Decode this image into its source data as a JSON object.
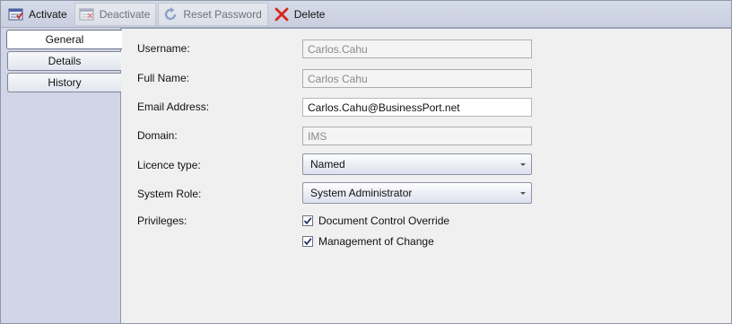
{
  "toolbar": {
    "activate_label": "Activate",
    "deactivate_label": "Deactivate",
    "reset_password_label": "Reset Password",
    "delete_label": "Delete"
  },
  "tabs": [
    {
      "label": "General",
      "active": true
    },
    {
      "label": "Details",
      "active": false
    },
    {
      "label": "History",
      "active": false
    }
  ],
  "form": {
    "username": {
      "label": "Username:",
      "value": "Carlos.Cahu",
      "editable": false
    },
    "full_name": {
      "label": "Full Name:",
      "value": "Carlos Cahu",
      "editable": false
    },
    "email": {
      "label": "Email Address:",
      "value": "Carlos.Cahu@BusinessPort.net",
      "editable": true
    },
    "domain": {
      "label": "Domain:",
      "value": "IMS",
      "editable": false
    },
    "licence_type": {
      "label": "Licence type:",
      "value": "Named"
    },
    "system_role": {
      "label": "System Role:",
      "value": "System Administrator"
    },
    "privileges": {
      "label": "Privileges:",
      "items": [
        {
          "label": "Document Control Override",
          "checked": true
        },
        {
          "label": "Management of Change",
          "checked": true
        }
      ]
    }
  },
  "colors": {
    "toolbar_bg": "#cdd3e4",
    "tabpane_bg": "#d2d5e7",
    "delete_red": "#d9261c"
  }
}
